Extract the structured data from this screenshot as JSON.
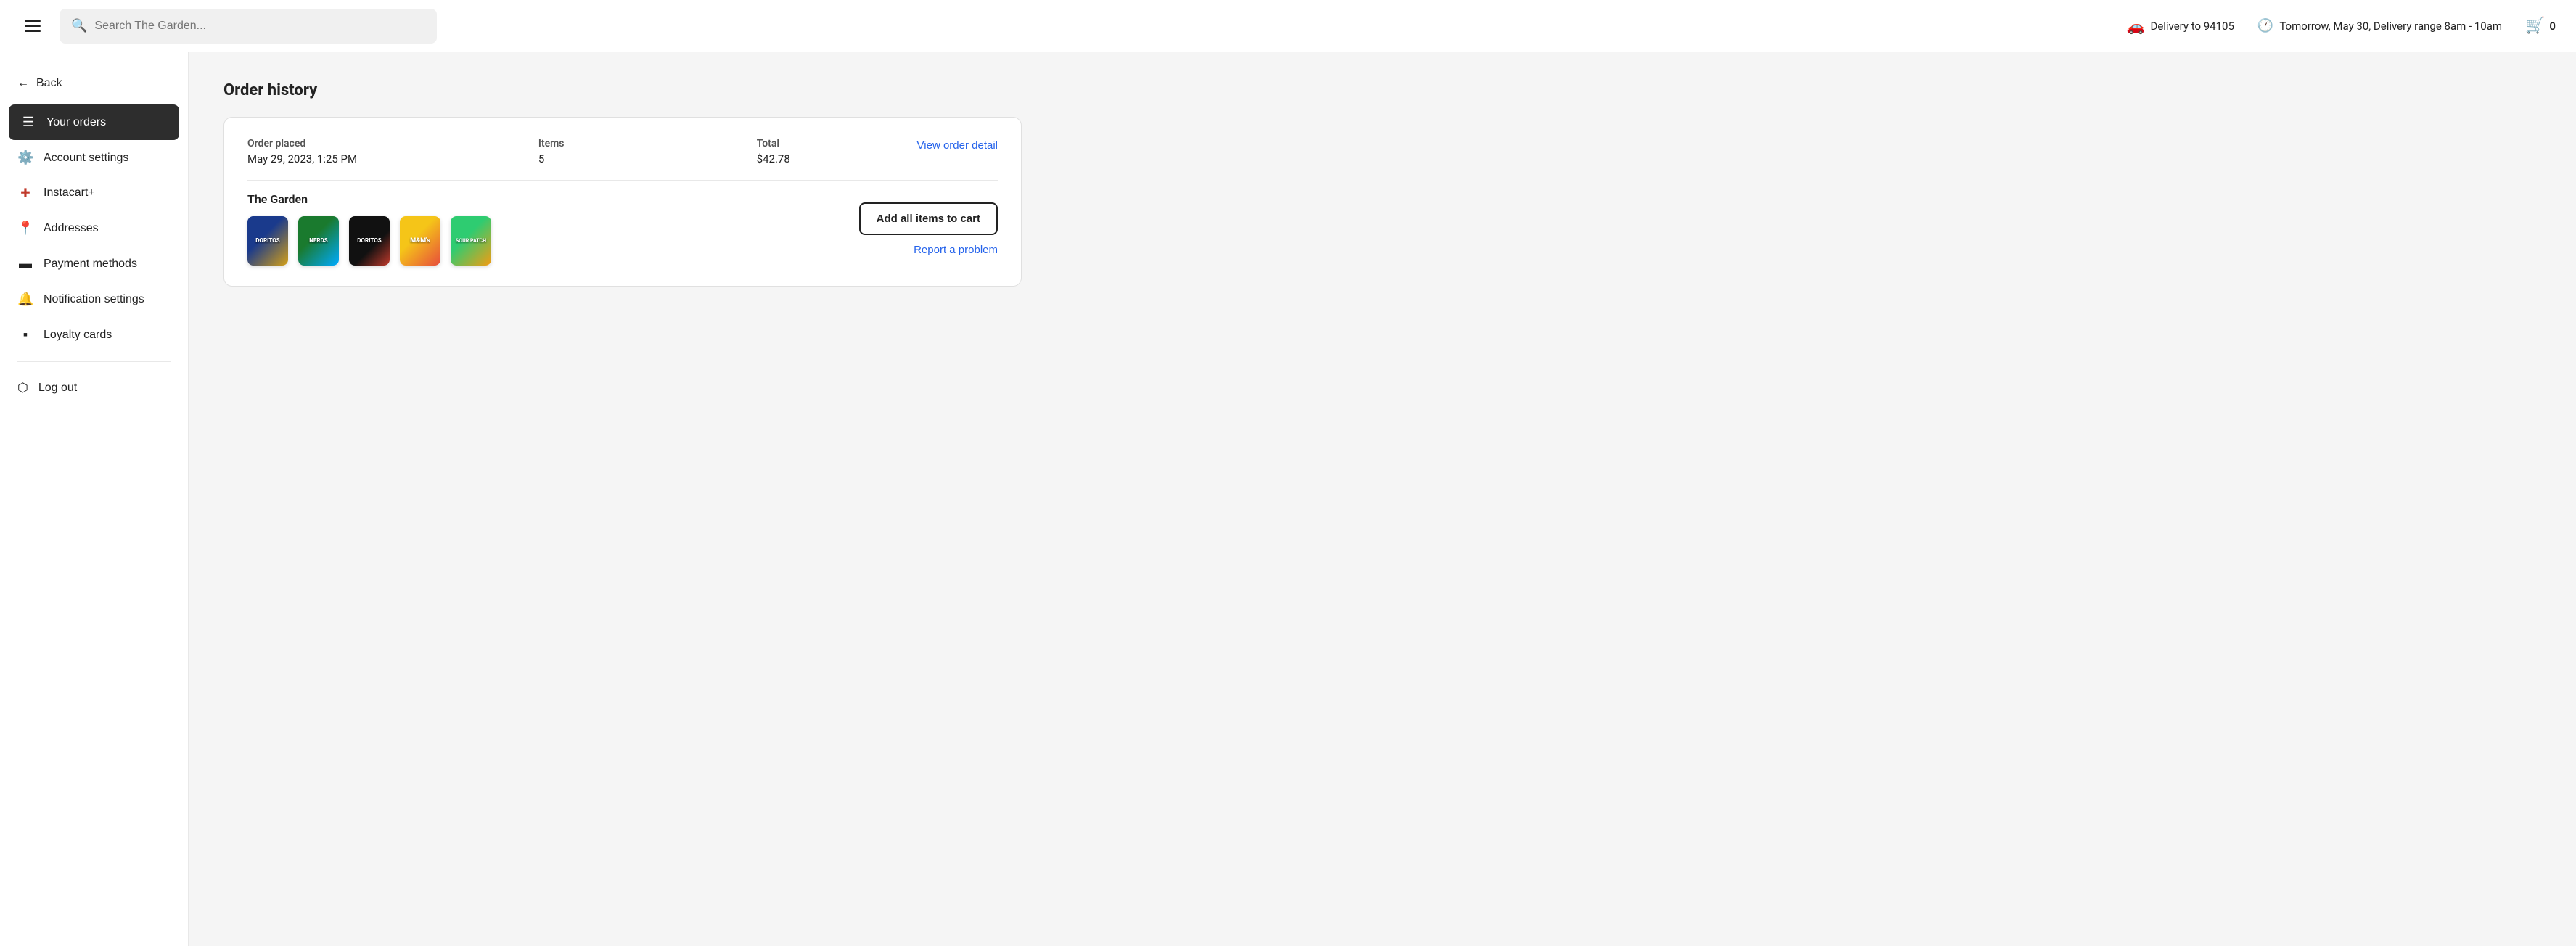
{
  "header": {
    "search_placeholder": "Search The Garden...",
    "delivery_label": "Delivery to 94105",
    "delivery_time": "Tomorrow, May 30, Delivery range 8am - 10am",
    "cart_count": "0"
  },
  "sidebar": {
    "back_label": "Back",
    "items": [
      {
        "id": "your-orders",
        "label": "Your orders",
        "icon": "📋",
        "active": true
      },
      {
        "id": "account-settings",
        "label": "Account settings",
        "icon": "⚙️",
        "active": false
      },
      {
        "id": "instacart-plus",
        "label": "Instacart+",
        "icon": "➕",
        "active": false
      },
      {
        "id": "addresses",
        "label": "Addresses",
        "icon": "📍",
        "active": false
      },
      {
        "id": "payment-methods",
        "label": "Payment methods",
        "icon": "💳",
        "active": false
      },
      {
        "id": "notification-settings",
        "label": "Notification settings",
        "icon": "🔔",
        "active": false
      },
      {
        "id": "loyalty-cards",
        "label": "Loyalty cards",
        "icon": "🪪",
        "active": false
      }
    ],
    "logout_label": "Log out",
    "logout_icon": "🚪"
  },
  "main": {
    "page_title": "Order history",
    "order": {
      "order_placed_label": "Order placed",
      "order_placed_value": "May 29, 2023, 1:25 PM",
      "items_label": "Items",
      "items_value": "5",
      "total_label": "Total",
      "total_value": "$42.78",
      "view_detail_label": "View order detail",
      "store_name": "The Garden",
      "add_to_cart_label": "Add all items to cart",
      "report_problem_label": "Report a problem",
      "products": [
        {
          "id": "doritos-blue",
          "name": "Doritos",
          "color1": "#1a3a8c",
          "color2": "#d4a017",
          "text": "DORITOS"
        },
        {
          "id": "nerds-green",
          "name": "Nerds",
          "color1": "#1a7a2e",
          "color2": "#00aaff",
          "text": "NERDS"
        },
        {
          "id": "doritos-black",
          "name": "Doritos Black",
          "color1": "#111111",
          "color2": "#c0392b",
          "text": "DORITOS"
        },
        {
          "id": "mms-yellow",
          "name": "M&Ms",
          "color1": "#f5c518",
          "color2": "#e74c3c",
          "text": "M&M's"
        },
        {
          "id": "sour-patch",
          "name": "Sour Patch",
          "color1": "#2ecc71",
          "color2": "#f39c12",
          "text": "SOUR PATCH"
        }
      ]
    }
  }
}
